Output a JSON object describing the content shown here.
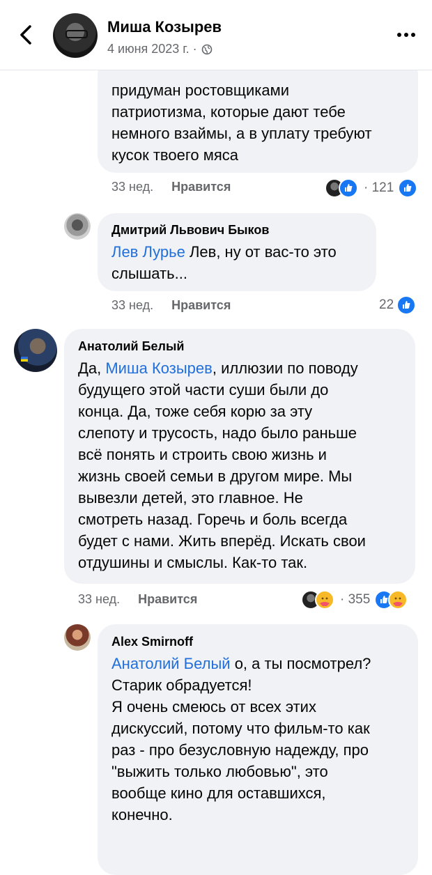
{
  "header": {
    "name": "Миша Козырев",
    "date": "4 июня 2023 г. ·"
  },
  "comments": [
    {
      "partial": true,
      "text_lines": [
        "придуман ростовщиками",
        "патриотизма, которые дают тебе",
        "немного взаймы, а в уплату требуют",
        "кусок твоего мяса"
      ],
      "time": "33 нед.",
      "like": "Нравится",
      "reaction_count": "· 121"
    },
    {
      "author": "Дмитрий Львович Быков",
      "mention": "Лев Лурье",
      "text_first": " Лев, ну от вас-то это",
      "text_lines": [
        "слышать..."
      ],
      "time": "33 нед.",
      "like": "Нравится",
      "reaction_count": "22"
    },
    {
      "author": "Анатолий Белый",
      "first_prefix": "Да, ",
      "mention": "Миша Козырев",
      "first_suffix": ", иллюзии по поводу",
      "text_lines": [
        "будущего этой части суши были до",
        "конца. Да, тоже себя корю за эту",
        "слепоту и трусость, надо было раньше",
        "всё понять и строить свою жизнь и",
        "жизнь своей семьи в другом мире. Мы",
        "вывезли детей, это главное. Не",
        "смотреть назад. Горечь и боль всегда",
        "будет с нами. Жить вперёд. Искать свои",
        "отдушины и смыслы. Как-то так."
      ],
      "time": "33 нед.",
      "like": "Нравится",
      "reaction_count": "· 355"
    },
    {
      "author": "Alex Smirnoff",
      "mention": "Анатолий Белый",
      "text_first": " о, а ты посмотрел?",
      "text_lines": [
        "Старик обрадуется!",
        "Я очень смеюсь от всех этих",
        "дискуссий, потому что фильм-то как",
        "раз - про безусловную надежду, про",
        "\"выжить только любовью\", это",
        "вообще кино для оставшихся,",
        "конечно."
      ]
    }
  ],
  "colors": {
    "mention": "#216fdb",
    "bubble": "#f0f2f5",
    "muted": "#65676b",
    "like_blue": "#1877f2"
  }
}
